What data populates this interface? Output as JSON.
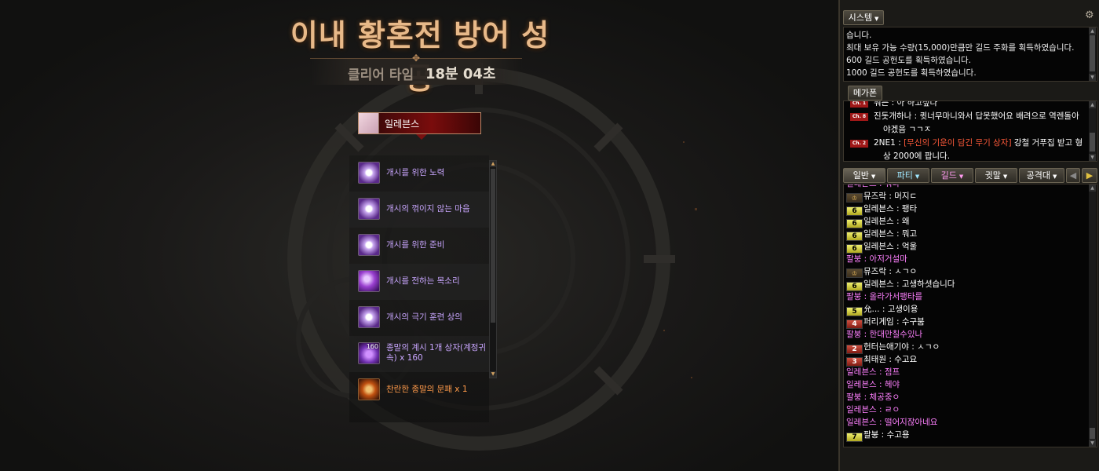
{
  "result": {
    "title": "이내 황혼전 방어 성공",
    "clear_label": "클리어 타임",
    "clear_time": "18분 04초"
  },
  "player": {
    "name": "일레븐스"
  },
  "rewards": [
    {
      "text": "개시를 위한 노력",
      "grade": "rare",
      "icon": "scroll-icon"
    },
    {
      "text": "개시의 꺾이지 않는 마음",
      "grade": "rare",
      "icon": "scroll-icon"
    },
    {
      "text": "개시를 위한 준비",
      "grade": "rare",
      "icon": "scroll-icon"
    },
    {
      "text": "개시를 전하는 목소리",
      "grade": "rare",
      "icon": "orb-icon"
    },
    {
      "text": "개시의 극기 훈련 상의",
      "grade": "rare",
      "icon": "scroll-icon"
    },
    {
      "text": "종말의 계시 1개 상자(계정귀속) x 160",
      "grade": "rare",
      "icon": "box-icon",
      "count": "160"
    },
    {
      "text": "찬란한 종말의 문패 x 1",
      "grade": "unique",
      "icon": "token-icon"
    }
  ],
  "chat": {
    "system_tab": "시스템",
    "system_lines": [
      "습니다.",
      "최대 보유 가능 수량(15,000)만큼만 길드 주화를 획득하였습니다.",
      "600 길드 공헌도를 획득하였습니다.",
      "1000 길드 공헌도를 획득하였습니다."
    ],
    "megaphone_tab": "메가폰",
    "mega_lines": [
      {
        "ch": "Ch. 1",
        "user": "뭐든",
        "text": "아 하고싶다"
      },
      {
        "ch": "Ch. 8",
        "user": "진돗개하나",
        "text": "큇너무마니와서 답못했어요 배려으로 역렌돌아",
        "cont": "야겠음 ㄱㄱㅈ"
      },
      {
        "ch": "Ch. 2",
        "user": "2NE1",
        "hl": "[무신의 기운이 담긴 무기 상자]",
        "text": " 강철 거푸집 받고 형",
        "cont": "상 2000에 팝니다."
      }
    ],
    "tabs": {
      "general": "일반",
      "party": "파티",
      "guild": "길드",
      "whisper": "귓말",
      "raid": "공격대"
    },
    "general_lines": [
      {
        "lvl": "",
        "text": "일레븐스 : 뭐냐",
        "color": "pink"
      },
      {
        "lvl": "crown",
        "text": "뮤즈락 : 머지ㄷ",
        "color": "white"
      },
      {
        "lvl": "6",
        "text": "일레븐스 : 팽타",
        "color": "white"
      },
      {
        "lvl": "6",
        "text": "일레븐스 : 왜",
        "color": "white"
      },
      {
        "lvl": "6",
        "text": "일레븐스 : 뭐고",
        "color": "white"
      },
      {
        "lvl": "6",
        "text": "일레븐스 : 억울",
        "color": "white"
      },
      {
        "lvl": "",
        "text": "팔붕 : 아저거설마",
        "color": "pink"
      },
      {
        "lvl": "crown",
        "text": "뮤즈락 : ㅅㄱㅇ",
        "color": "white"
      },
      {
        "lvl": "6",
        "text": "일레븐스 : 고생하셧습니다",
        "color": "white"
      },
      {
        "lvl": "",
        "text": "팔붕 : 올라가서팽타를",
        "color": "pink"
      },
      {
        "lvl": "5",
        "text": "允... : 고생이용",
        "color": "white"
      },
      {
        "lvl": "4r",
        "text": "퍼리게임 : 수구붐",
        "color": "white"
      },
      {
        "lvl": "",
        "text": "팔붕 : 한대만칠수있나",
        "color": "pink"
      },
      {
        "lvl": "2r",
        "text": "헌터는애기야 : ㅅㄱㅇ",
        "color": "white"
      },
      {
        "lvl": "3r",
        "text": "최태원 : 수고요",
        "color": "white"
      },
      {
        "lvl": "",
        "text": "일레븐스 : 점프",
        "color": "pink"
      },
      {
        "lvl": "",
        "text": "일레븐스 : 헤야",
        "color": "pink"
      },
      {
        "lvl": "",
        "text": "팔붕 : 체공중ㅇ",
        "color": "pink"
      },
      {
        "lvl": "",
        "text": "일레븐스 : ㄹㅇ",
        "color": "pink"
      },
      {
        "lvl": "",
        "text": "일레븐스 : 떨어지잖아네요",
        "color": "pink"
      },
      {
        "lvl": "7",
        "text": "팔붕 : 수고용",
        "color": "white"
      }
    ]
  }
}
